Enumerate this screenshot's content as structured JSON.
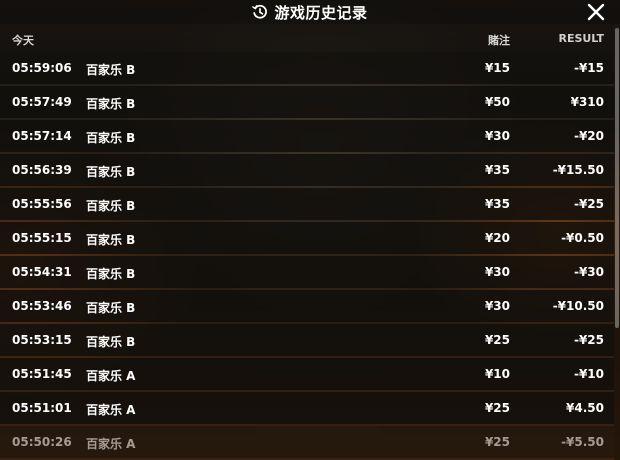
{
  "header": {
    "title": "游戏历史记录",
    "history_icon": "history-clock-icon",
    "close_icon": "close-icon"
  },
  "columns": {
    "date": "今天",
    "bet": "賭注",
    "result": "RESULT"
  },
  "rows": [
    {
      "time": "05:59:06",
      "game": "百家乐 B",
      "bet": "¥15",
      "result": "-¥15"
    },
    {
      "time": "05:57:49",
      "game": "百家乐 B",
      "bet": "¥50",
      "result": "¥310"
    },
    {
      "time": "05:57:14",
      "game": "百家乐 B",
      "bet": "¥30",
      "result": "-¥20"
    },
    {
      "time": "05:56:39",
      "game": "百家乐 B",
      "bet": "¥35",
      "result": "-¥15.50"
    },
    {
      "time": "05:55:56",
      "game": "百家乐 B",
      "bet": "¥35",
      "result": "-¥25"
    },
    {
      "time": "05:55:15",
      "game": "百家乐 B",
      "bet": "¥20",
      "result": "-¥0.50"
    },
    {
      "time": "05:54:31",
      "game": "百家乐 B",
      "bet": "¥30",
      "result": "-¥30"
    },
    {
      "time": "05:53:46",
      "game": "百家乐 B",
      "bet": "¥30",
      "result": "-¥10.50"
    },
    {
      "time": "05:53:15",
      "game": "百家乐 B",
      "bet": "¥25",
      "result": "-¥25"
    },
    {
      "time": "05:51:45",
      "game": "百家乐 A",
      "bet": "¥10",
      "result": "-¥10"
    },
    {
      "time": "05:51:01",
      "game": "百家乐 A",
      "bet": "¥25",
      "result": "¥4.50"
    },
    {
      "time": "05:50:26",
      "game": "百家乐 A",
      "bet": "¥25",
      "result": "-¥5.50"
    }
  ]
}
